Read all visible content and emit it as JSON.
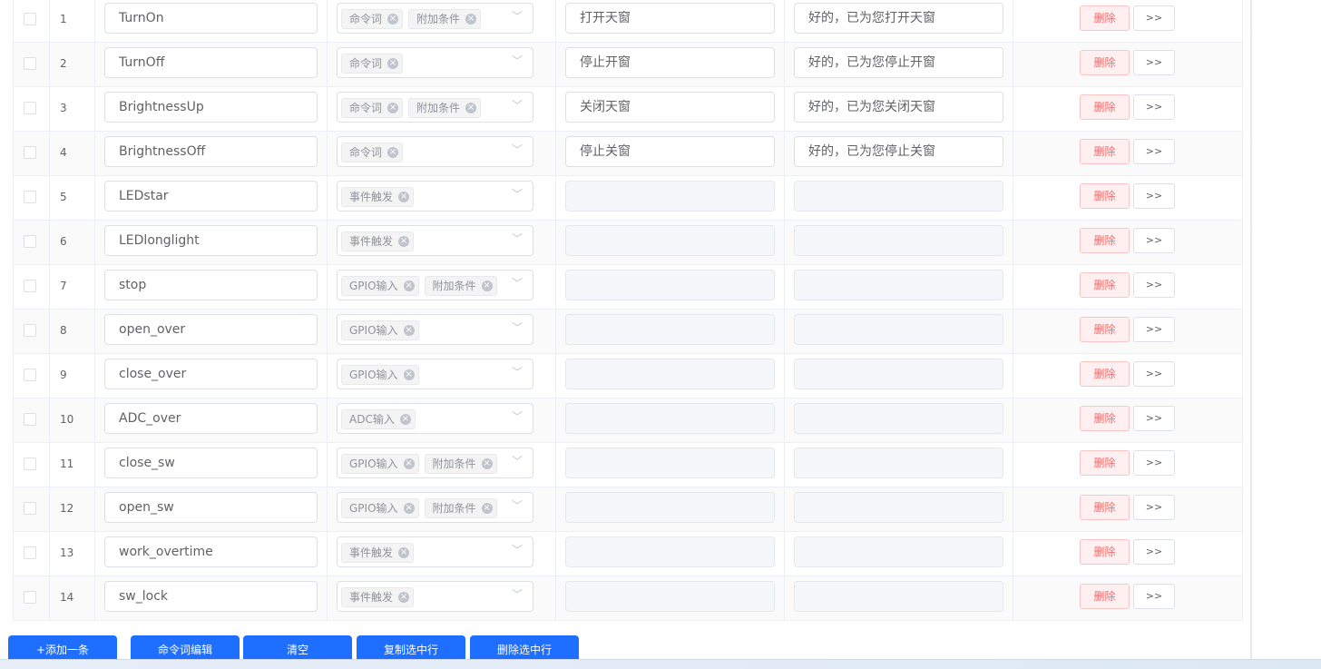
{
  "table": {
    "delete_label": "删除",
    "more_label": ">>",
    "rows": [
      {
        "index": "1",
        "name": "TurnOn",
        "tags": [
          "命令词",
          "附加条件"
        ],
        "command": "打开天窗",
        "reply": "好的，已为您打开天窗"
      },
      {
        "index": "2",
        "name": "TurnOff",
        "tags": [
          "命令词"
        ],
        "command": "停止开窗",
        "reply": "好的，已为您停止开窗"
      },
      {
        "index": "3",
        "name": "BrightnessUp",
        "tags": [
          "命令词",
          "附加条件"
        ],
        "command": "关闭天窗",
        "reply": "好的，已为您关闭天窗"
      },
      {
        "index": "4",
        "name": "BrightnessOff",
        "tags": [
          "命令词"
        ],
        "command": "停止关窗",
        "reply": "好的，已为您停止关窗"
      },
      {
        "index": "5",
        "name": "LEDstar",
        "tags": [
          "事件触发"
        ],
        "command": "",
        "reply": ""
      },
      {
        "index": "6",
        "name": "LEDlonglight",
        "tags": [
          "事件触发"
        ],
        "command": "",
        "reply": ""
      },
      {
        "index": "7",
        "name": "stop",
        "tags": [
          "GPIO输入",
          "附加条件"
        ],
        "command": "",
        "reply": ""
      },
      {
        "index": "8",
        "name": "open_over",
        "tags": [
          "GPIO输入"
        ],
        "command": "",
        "reply": ""
      },
      {
        "index": "9",
        "name": "close_over",
        "tags": [
          "GPIO输入"
        ],
        "command": "",
        "reply": ""
      },
      {
        "index": "10",
        "name": "ADC_over",
        "tags": [
          "ADC输入"
        ],
        "command": "",
        "reply": ""
      },
      {
        "index": "11",
        "name": "close_sw",
        "tags": [
          "GPIO输入",
          "附加条件"
        ],
        "command": "",
        "reply": ""
      },
      {
        "index": "12",
        "name": "open_sw",
        "tags": [
          "GPIO输入",
          "附加条件"
        ],
        "command": "",
        "reply": ""
      },
      {
        "index": "13",
        "name": "work_overtime",
        "tags": [
          "事件触发"
        ],
        "command": "",
        "reply": ""
      },
      {
        "index": "14",
        "name": "sw_lock",
        "tags": [
          "事件触发"
        ],
        "command": "",
        "reply": ""
      }
    ]
  },
  "toolbar": {
    "add_label": "+添加一条",
    "edit_commands_label": "命令词编辑",
    "clear_label": "清空",
    "copy_selected_label": "复制选中行",
    "delete_selected_label": "删除选中行"
  },
  "icons": {
    "tag_close": "close-circle-icon",
    "select_arrow": "chevron-down-icon"
  },
  "colors": {
    "primary": "#1e6eff",
    "danger": "#f56c6c",
    "danger_bg": "#fef0f0"
  }
}
